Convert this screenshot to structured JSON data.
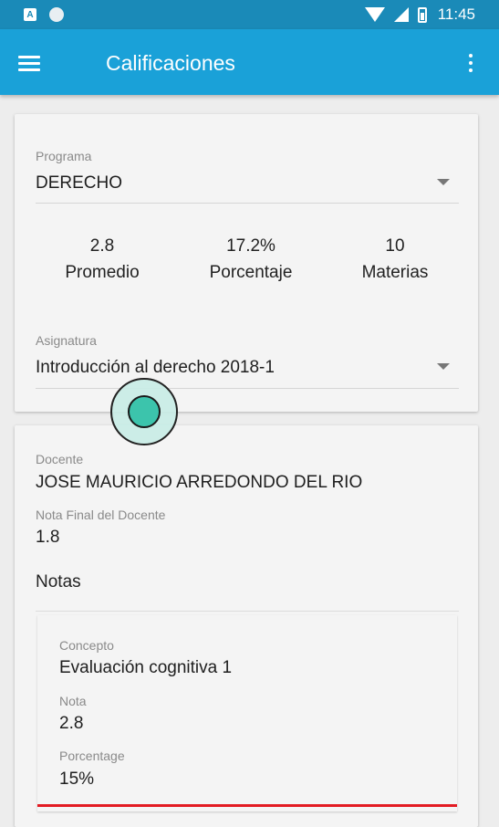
{
  "status_bar": {
    "time": "11:45",
    "notification_icon_letter": "A",
    "icons": [
      "notification-a-icon",
      "circle-icon",
      "wifi-icon",
      "signal-icon",
      "battery-icon"
    ]
  },
  "app_bar": {
    "title": "Calificaciones",
    "background_color": "#1aa1d8",
    "icons": [
      "menu-icon",
      "more-vert-icon"
    ]
  },
  "summary_card": {
    "programa": {
      "label": "Programa",
      "value": "DERECHO"
    },
    "stats": [
      {
        "value": "2.8",
        "label": "Promedio"
      },
      {
        "value": "17.2%",
        "label": "Porcentaje"
      },
      {
        "value": "10",
        "label": "Materias"
      }
    ],
    "asignatura": {
      "label": "Asignatura",
      "value": "Introducción al derecho 2018-1"
    }
  },
  "detail_card": {
    "docente": {
      "label": "Docente",
      "value": "JOSE MAURICIO ARREDONDO DEL RIO"
    },
    "nota_final": {
      "label": "Nota Final del Docente",
      "value": "1.8"
    },
    "notas_title": "Notas",
    "notas": [
      {
        "concepto_label": "Concepto",
        "concepto": "Evaluación cognitiva 1",
        "nota_label": "Nota",
        "nota": "2.8",
        "porcentaje_label": "Porcentage",
        "porcentaje": "15%",
        "status_color": "#e31b23"
      }
    ]
  }
}
